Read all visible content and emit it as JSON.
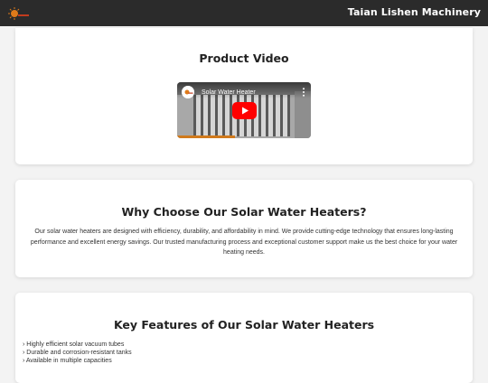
{
  "header": {
    "brand": "Taian Lishen Machinery",
    "logo_icon": "sun-logo-icon",
    "background": "#2b2b2b"
  },
  "video_section": {
    "title": "Product Video",
    "video": {
      "title": "Solar Water Heater",
      "play_icon": "youtube-play-icon",
      "menu_icon": "more-vert-icon",
      "progress": 0.43
    }
  },
  "why_section": {
    "title": "Why Choose Our Solar Water Heaters?",
    "body": "Our solar water heaters are designed with efficiency, durability, and affordability in mind. We provide cutting-edge technology that ensures long-lasting performance and excellent energy savings. Our trusted manufacturing process and exceptional customer support make us the best choice for your water heating needs."
  },
  "features_section": {
    "title": "Key Features of Our Solar Water Heaters",
    "items": [
      "Highly efficient solar vacuum tubes",
      "Durable and corrosion-resistant tanks",
      "Available in multiple capacities"
    ]
  },
  "colors": {
    "page_bg": "#f3f3f3",
    "card_bg": "#ffffff",
    "play_red": "#ff0000",
    "accent_orange": "#d07a1c"
  }
}
